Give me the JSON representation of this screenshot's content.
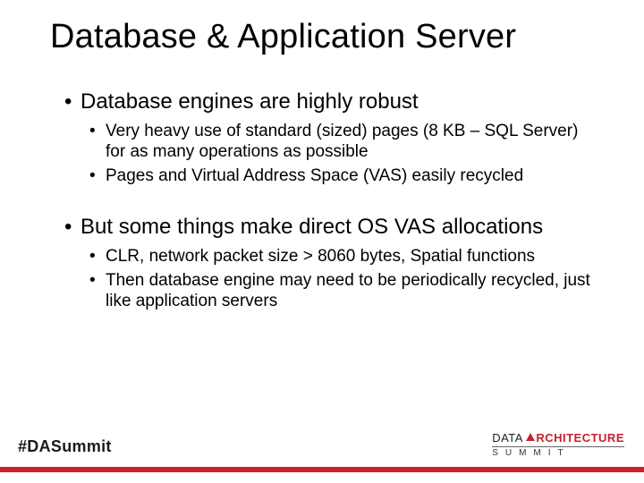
{
  "title": "Database & Application Server",
  "bullets": {
    "b1a": "Database engines are highly robust",
    "b1a_subs": [
      "Very heavy use of standard (sized) pages (8 KB – SQL Server) for as many operations as possible",
      "Pages and Virtual Address Space (VAS) easily recycled"
    ],
    "b1b": "But some things make direct OS VAS allocations",
    "b1b_subs": [
      "CLR, network packet size > 8060 bytes, Spatial functions",
      "Then database engine may need to be periodically recycled, just like application servers"
    ]
  },
  "footer": {
    "hashtag": "#DASummit",
    "logo_data": "DATA ",
    "logo_arch": "RCHITECTURE",
    "logo_summit": "SUMMIT"
  }
}
